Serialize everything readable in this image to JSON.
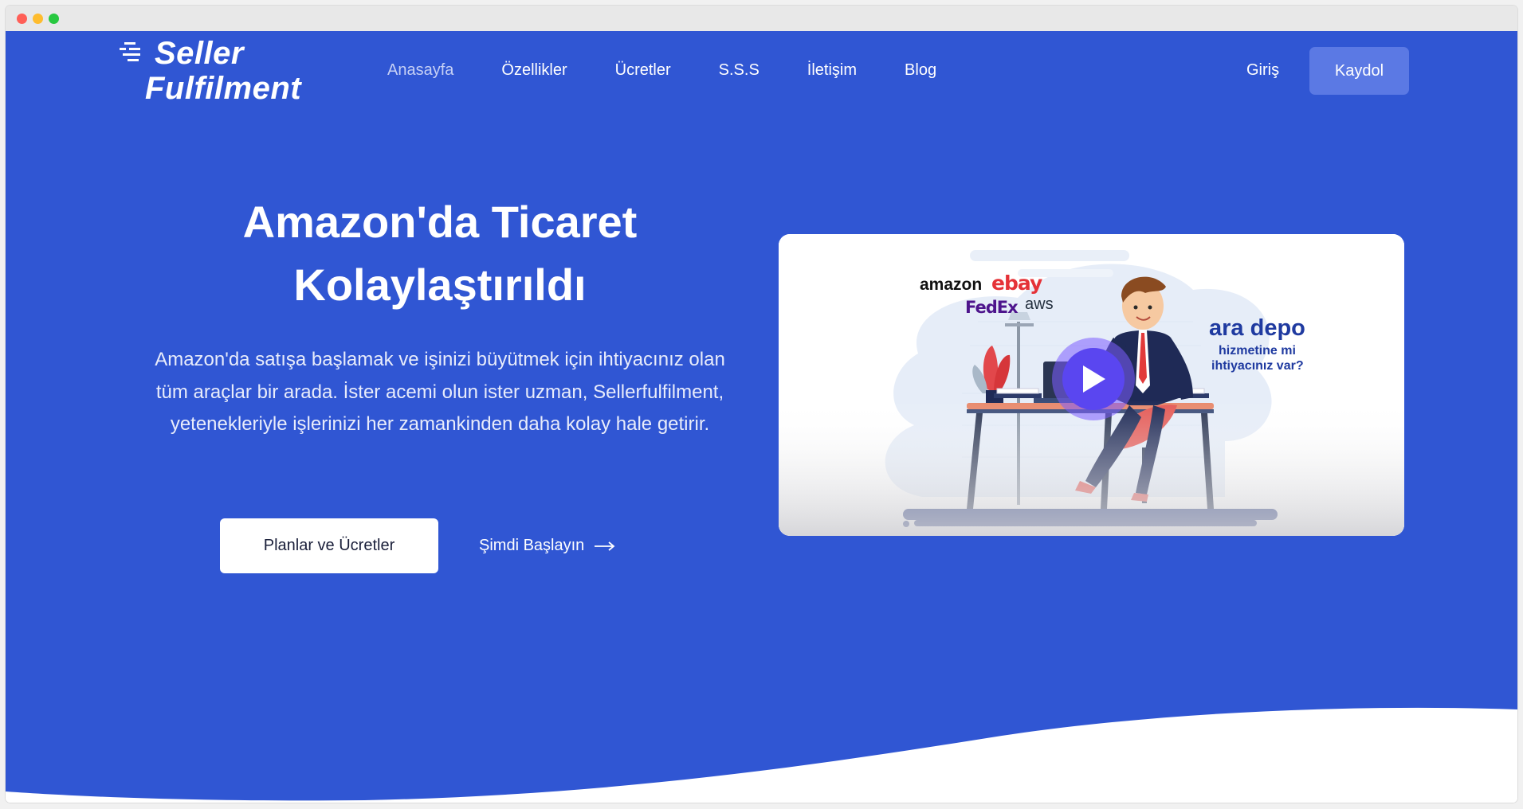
{
  "logo": {
    "line1": "Seller",
    "line2": "Fulfilment"
  },
  "nav": {
    "items": [
      {
        "label": "Anasayfa",
        "active": true
      },
      {
        "label": "Özellikler",
        "active": false
      },
      {
        "label": "Ücretler",
        "active": false
      },
      {
        "label": "S.S.S",
        "active": false
      },
      {
        "label": "İletişim",
        "active": false
      },
      {
        "label": "Blog",
        "active": false
      }
    ],
    "login_label": "Giriş",
    "signup_label": "Kaydol"
  },
  "hero": {
    "title_line1": "Amazon'da Ticaret",
    "title_line2": "Kolaylaştırıldı",
    "description": "Amazon'da satışa başlamak ve işinizi büyütmek için ihtiyacınız olan tüm araçlar bir arada. İster acemi olun ister uzman, Sellerfulfilment, yetenekleriyle işlerinizi her zamankinden daha kolay hale getirir.",
    "primary_button": "Planlar ve Ücretler",
    "secondary_link": "Şimdi Başlayın"
  },
  "video": {
    "brands": {
      "amazon": "amazon",
      "ebay": "ebay",
      "fedex": "FedEx",
      "aws": "aws"
    },
    "promo_line1": "ara depo",
    "promo_line2": "hizmetine mi",
    "promo_line3": "ihtiyacınız var?"
  },
  "colors": {
    "hero_blue": "#3056d3",
    "signup_button": "#5b79e4",
    "play_button": "#5a46f0",
    "promo_text": "#1f3aa0"
  },
  "icons": {
    "window_controls": [
      "close-dot",
      "minimize-dot",
      "maximize-dot"
    ],
    "play": "play-icon",
    "arrow": "arrow-right-icon",
    "logo_speed": "speed-lines-icon"
  }
}
